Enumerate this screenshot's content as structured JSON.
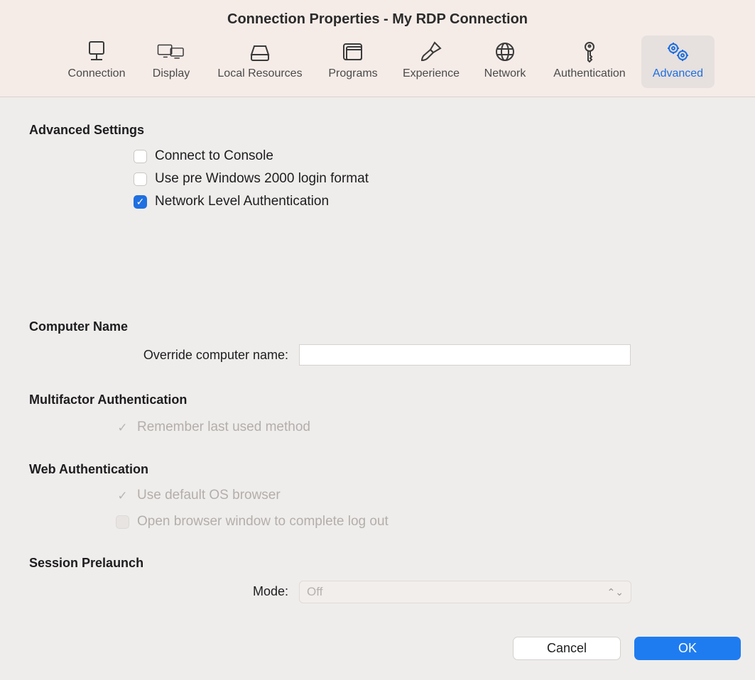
{
  "window": {
    "title": "Connection Properties - My RDP Connection"
  },
  "tabs": [
    {
      "label": "Connection",
      "icon": "monitor-icon"
    },
    {
      "label": "Display",
      "icon": "displays-icon"
    },
    {
      "label": "Local Resources",
      "icon": "drive-icon"
    },
    {
      "label": "Programs",
      "icon": "window-icon"
    },
    {
      "label": "Experience",
      "icon": "brush-icon"
    },
    {
      "label": "Network",
      "icon": "globe-icon"
    },
    {
      "label": "Authentication",
      "icon": "key-icon"
    },
    {
      "label": "Advanced",
      "icon": "gears-icon",
      "active": true
    }
  ],
  "advanced": {
    "heading": "Advanced Settings",
    "connect_console": "Connect to Console",
    "pre_win2000": "Use pre Windows 2000 login format",
    "nla": "Network Level Authentication"
  },
  "computer_name": {
    "heading": "Computer Name",
    "label": "Override computer name:",
    "value": ""
  },
  "mfa": {
    "heading": "Multifactor Authentication",
    "remember": "Remember last used method"
  },
  "web_auth": {
    "heading": "Web Authentication",
    "default_browser": "Use default OS browser",
    "open_browser_logout": "Open browser window to complete log out"
  },
  "prelaunch": {
    "heading": "Session Prelaunch",
    "mode_label": "Mode:",
    "mode_value": "Off"
  },
  "buttons": {
    "cancel": "Cancel",
    "ok": "OK"
  },
  "colors": {
    "accent": "#1f6fe0",
    "ok_button": "#1f7cf0"
  }
}
